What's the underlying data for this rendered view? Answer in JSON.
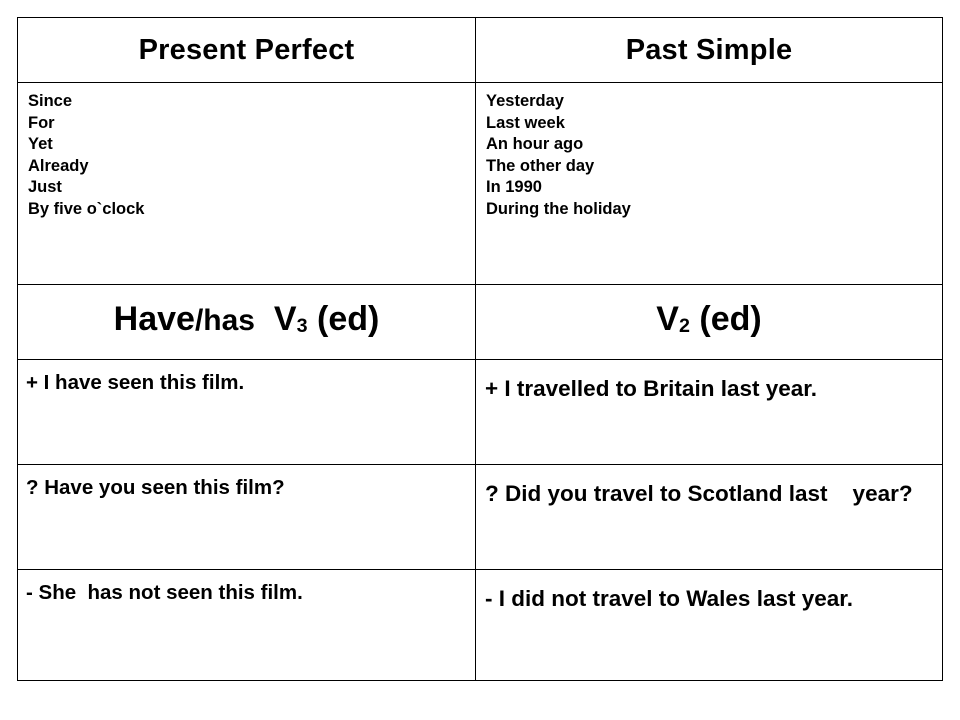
{
  "table": {
    "columns": [
      {
        "id": "present-perfect",
        "header": "Present Perfect"
      },
      {
        "id": "past-simple",
        "header": "Past Simple"
      }
    ],
    "markers": {
      "present_perfect": [
        "Since",
        "For",
        "Yet",
        "Already",
        "Just",
        "By five o`clock"
      ],
      "past_simple": [
        "Yesterday",
        "Last week",
        "An hour ago",
        "The other day",
        "In 1990",
        "During the holiday"
      ]
    },
    "formula": {
      "present_perfect": {
        "main": "Have",
        "secondary": "/has",
        "verb": "V",
        "verb_form": "3",
        "ending": " (ed)"
      },
      "past_simple": {
        "main": "",
        "secondary": "",
        "verb": "V",
        "verb_form": "2",
        "ending": " (ed)"
      }
    },
    "examples": [
      {
        "type": "affirmative",
        "present_perfect": "+ I have seen this film.",
        "past_simple": "+ I travelled to Britain last year."
      },
      {
        "type": "interrogative",
        "present_perfect": "? Have you seen this film?",
        "past_simple": "? Did you travel to Scotland last    year?"
      },
      {
        "type": "negative",
        "present_perfect": "- She  has not seen this film.",
        "past_simple": "- I did not travel to Wales last year."
      }
    ]
  },
  "colors": {
    "border": "#000000",
    "text": "#000000",
    "background": "#ffffff"
  }
}
